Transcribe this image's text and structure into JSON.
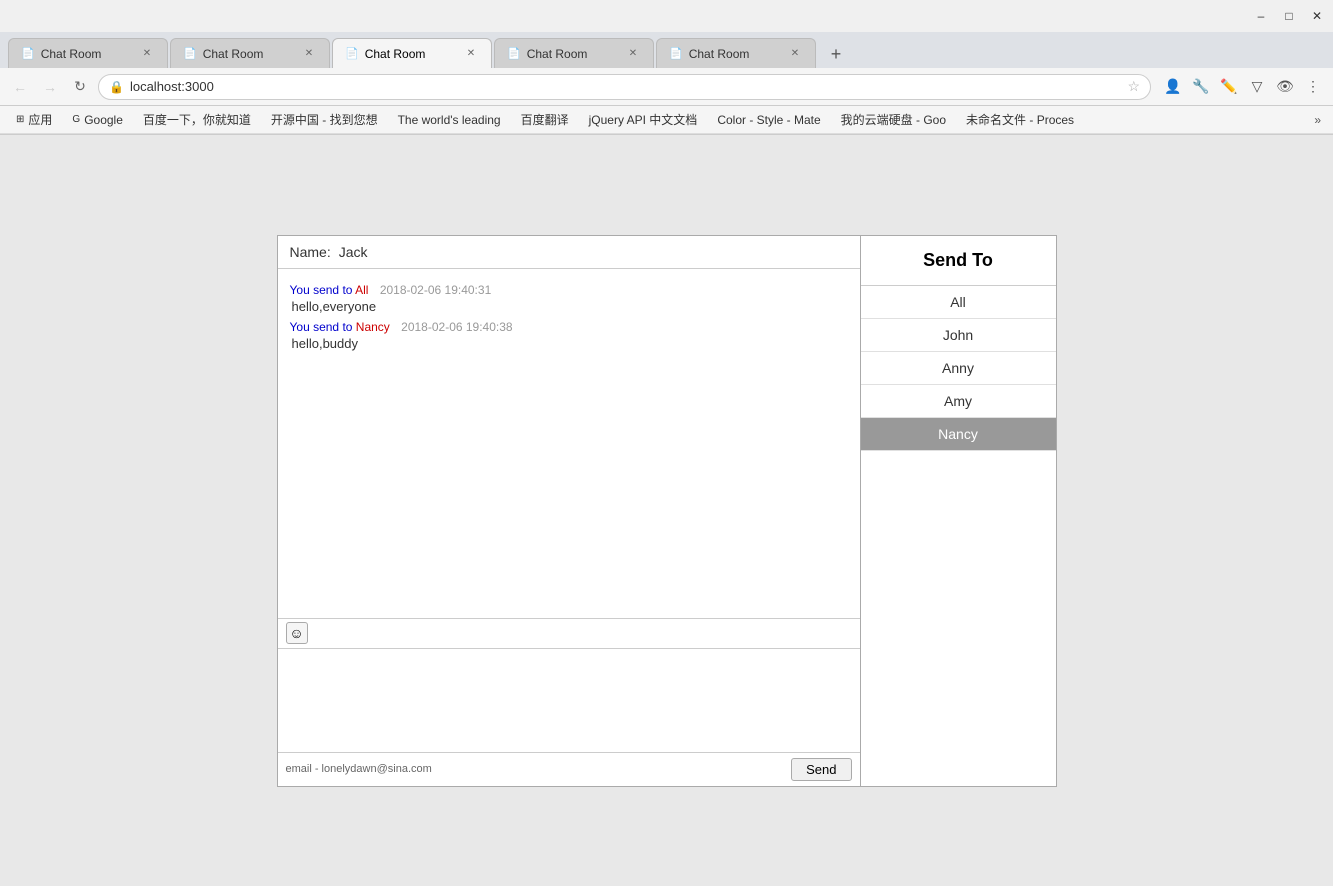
{
  "browser": {
    "tabs": [
      {
        "id": "tab1",
        "label": "Chat Room",
        "active": false,
        "icon": "📄"
      },
      {
        "id": "tab2",
        "label": "Chat Room",
        "active": false,
        "icon": "📄"
      },
      {
        "id": "tab3",
        "label": "Chat Room",
        "active": true,
        "icon": "📄"
      },
      {
        "id": "tab4",
        "label": "Chat Room",
        "active": false,
        "icon": "📄"
      },
      {
        "id": "tab5",
        "label": "Chat Room",
        "active": false,
        "icon": "📄"
      }
    ],
    "address": "localhost:3000",
    "bookmarks": [
      {
        "label": "应用"
      },
      {
        "label": "Google",
        "icon": "G"
      },
      {
        "label": "百度一下，你就知道"
      },
      {
        "label": "开源中国 - 找到您想"
      },
      {
        "label": "The world's leading"
      },
      {
        "label": "百度翻译"
      },
      {
        "label": "jQuery API 中文文档"
      },
      {
        "label": "Color - Style - Mate"
      },
      {
        "label": "我的云端硬盘 - Goo"
      },
      {
        "label": "未命名文件 - Proces"
      }
    ]
  },
  "chat": {
    "name_label": "Name:",
    "name_value": "Jack",
    "messages": [
      {
        "id": "msg1",
        "meta_prefix": "You send to",
        "target": "All",
        "timestamp": "2018-02-06 19:40:31",
        "text": "hello,everyone"
      },
      {
        "id": "msg2",
        "meta_prefix": "You send to",
        "target": "Nancy",
        "timestamp": "2018-02-06 19:40:38",
        "text": "hello,buddy"
      }
    ],
    "send_to_header": "Send To",
    "recipients": [
      {
        "id": "all",
        "label": "All",
        "selected": false
      },
      {
        "id": "john",
        "label": "John",
        "selected": false
      },
      {
        "id": "anny",
        "label": "Anny",
        "selected": false
      },
      {
        "id": "amy",
        "label": "Amy",
        "selected": false
      },
      {
        "id": "nancy",
        "label": "Nancy",
        "selected": true
      }
    ],
    "email": "email - lonelydawn@sina.com",
    "send_button": "Send",
    "textarea_value": ""
  }
}
